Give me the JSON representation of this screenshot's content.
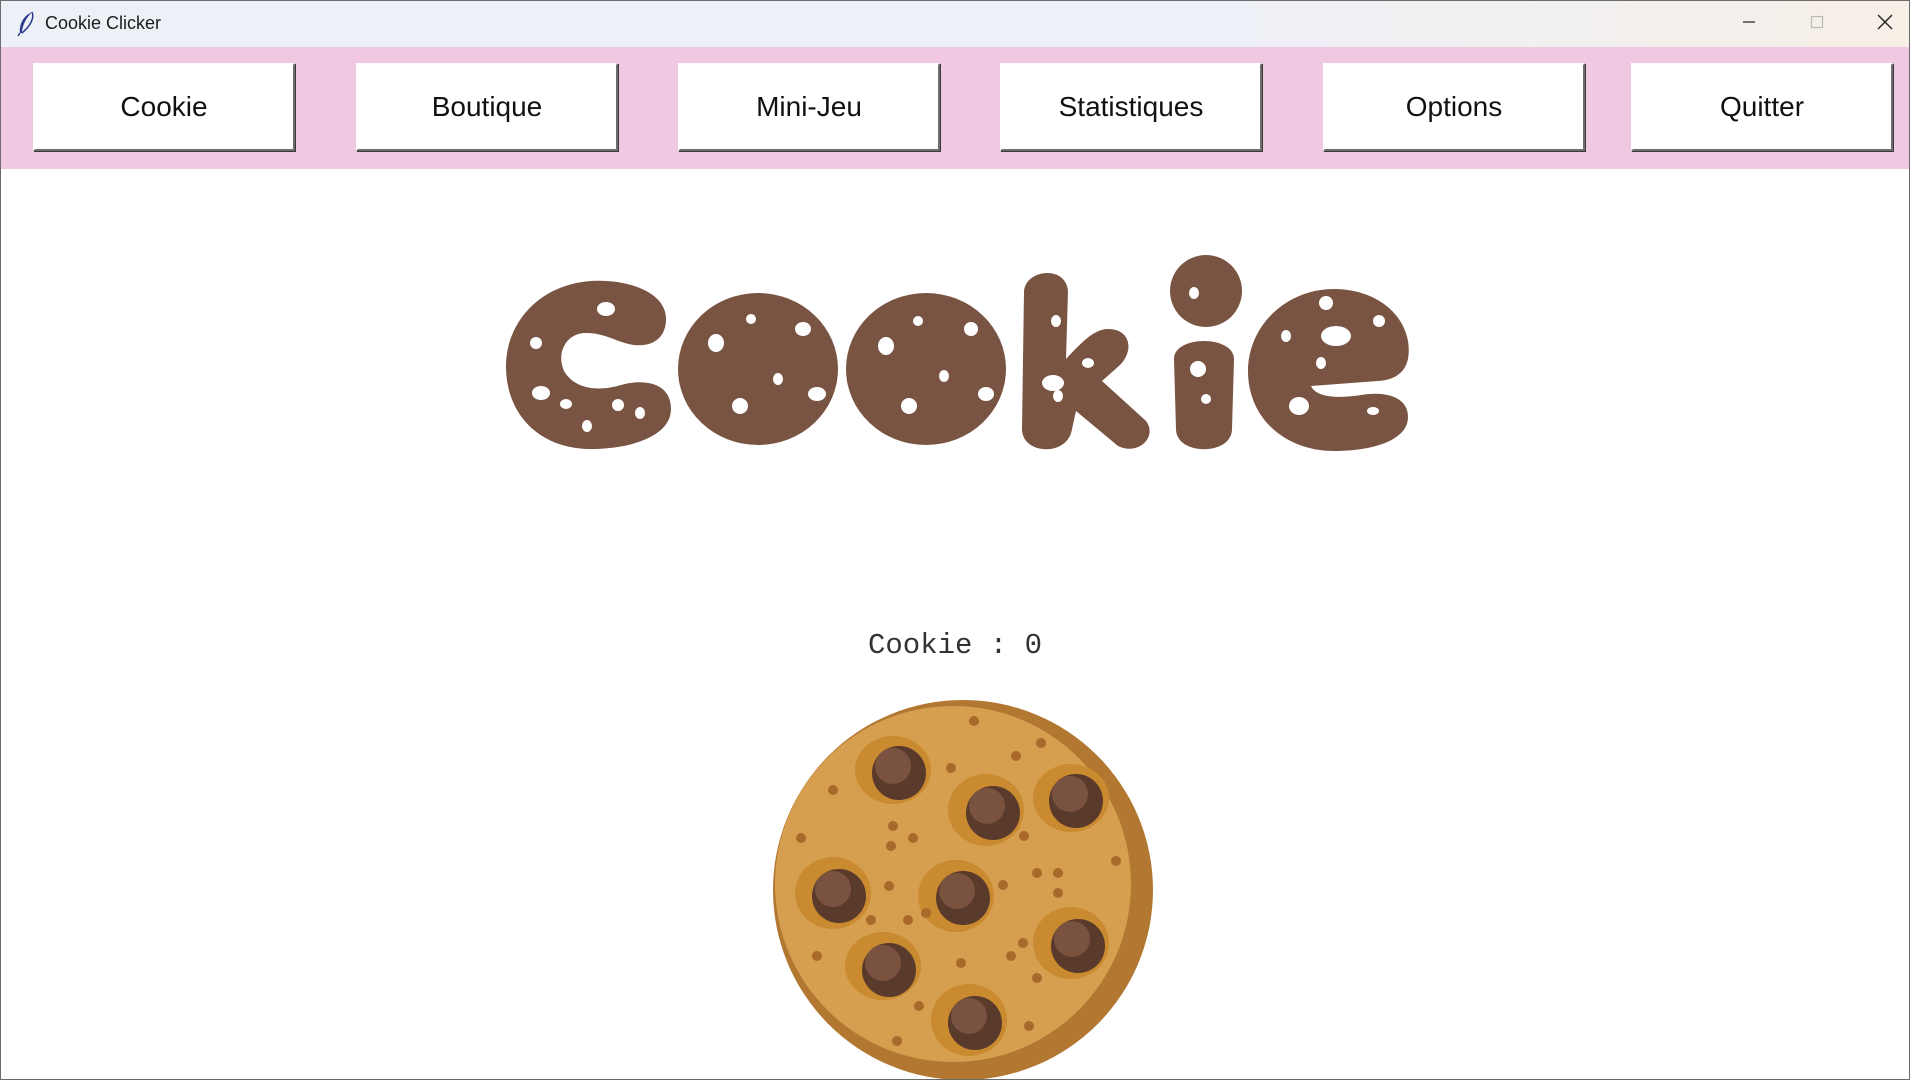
{
  "window": {
    "title": "Cookie Clicker",
    "app_icon": "feather-icon",
    "controls": [
      "minimize-icon",
      "maximize-icon",
      "close-icon"
    ]
  },
  "nav": {
    "background": "#f0c8e2",
    "buttons": [
      {
        "label": "Cookie"
      },
      {
        "label": "Boutique"
      },
      {
        "label": "Mini-Jeu"
      },
      {
        "label": "Statistiques"
      },
      {
        "label": "Options"
      },
      {
        "label": "Quitter"
      }
    ]
  },
  "main": {
    "logo_text": "Cookie",
    "logo_color": "#7a5442",
    "counter_text": "Cookie : 0",
    "cookie_icon": "chocolate-chip-cookie-icon"
  }
}
